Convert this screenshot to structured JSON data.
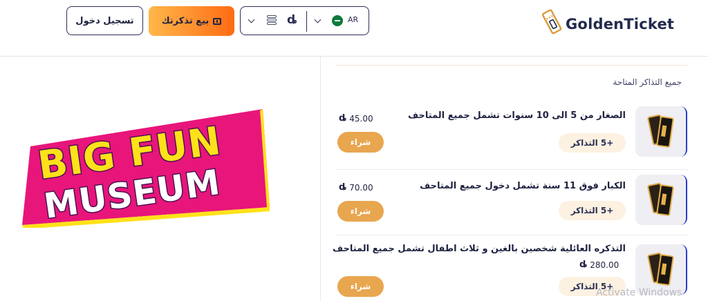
{
  "header": {
    "login_label": "تسجيل دخول",
    "sell_label": "بيع تذكرتك",
    "currency_symbol": "ȡ",
    "language_code": "AR",
    "brand_name": "GoldenTicket"
  },
  "banner": {
    "line1": "BIG FUN",
    "line2": "MUSEUM"
  },
  "tickets": {
    "section_title": "جميع التذاكر المتاحة",
    "currency_symbol": "ȡ",
    "items": [
      {
        "name": "الصغار من 5 الى 10 سنوات تشمل جميع المتاحف",
        "price": "45.00",
        "badge": "+5 التذاكر",
        "buy_label": "شراء"
      },
      {
        "name": "الكبار فوق 11 سنة تشمل دخول جميع المتاحف",
        "price": "70.00",
        "badge": "+5 التذاكر",
        "buy_label": "شراء"
      },
      {
        "name": "التذكره العائلية شخصين بالغين و ثلاث اطفال تشمل جميع المتاحف",
        "price": "280.00",
        "badge": "+5 التذاكر",
        "buy_label": "شراء"
      }
    ]
  },
  "watermark": "Activate Windows",
  "colors": {
    "navy": "#1f2240",
    "orange_gradient_start": "#ffb74a",
    "orange_gradient_end": "#ff6b12",
    "buy_button": "#e8a64f",
    "badge_bg": "#fdf1e1",
    "banner_pink": "#e8157b",
    "banner_yellow": "#ffe11a"
  }
}
